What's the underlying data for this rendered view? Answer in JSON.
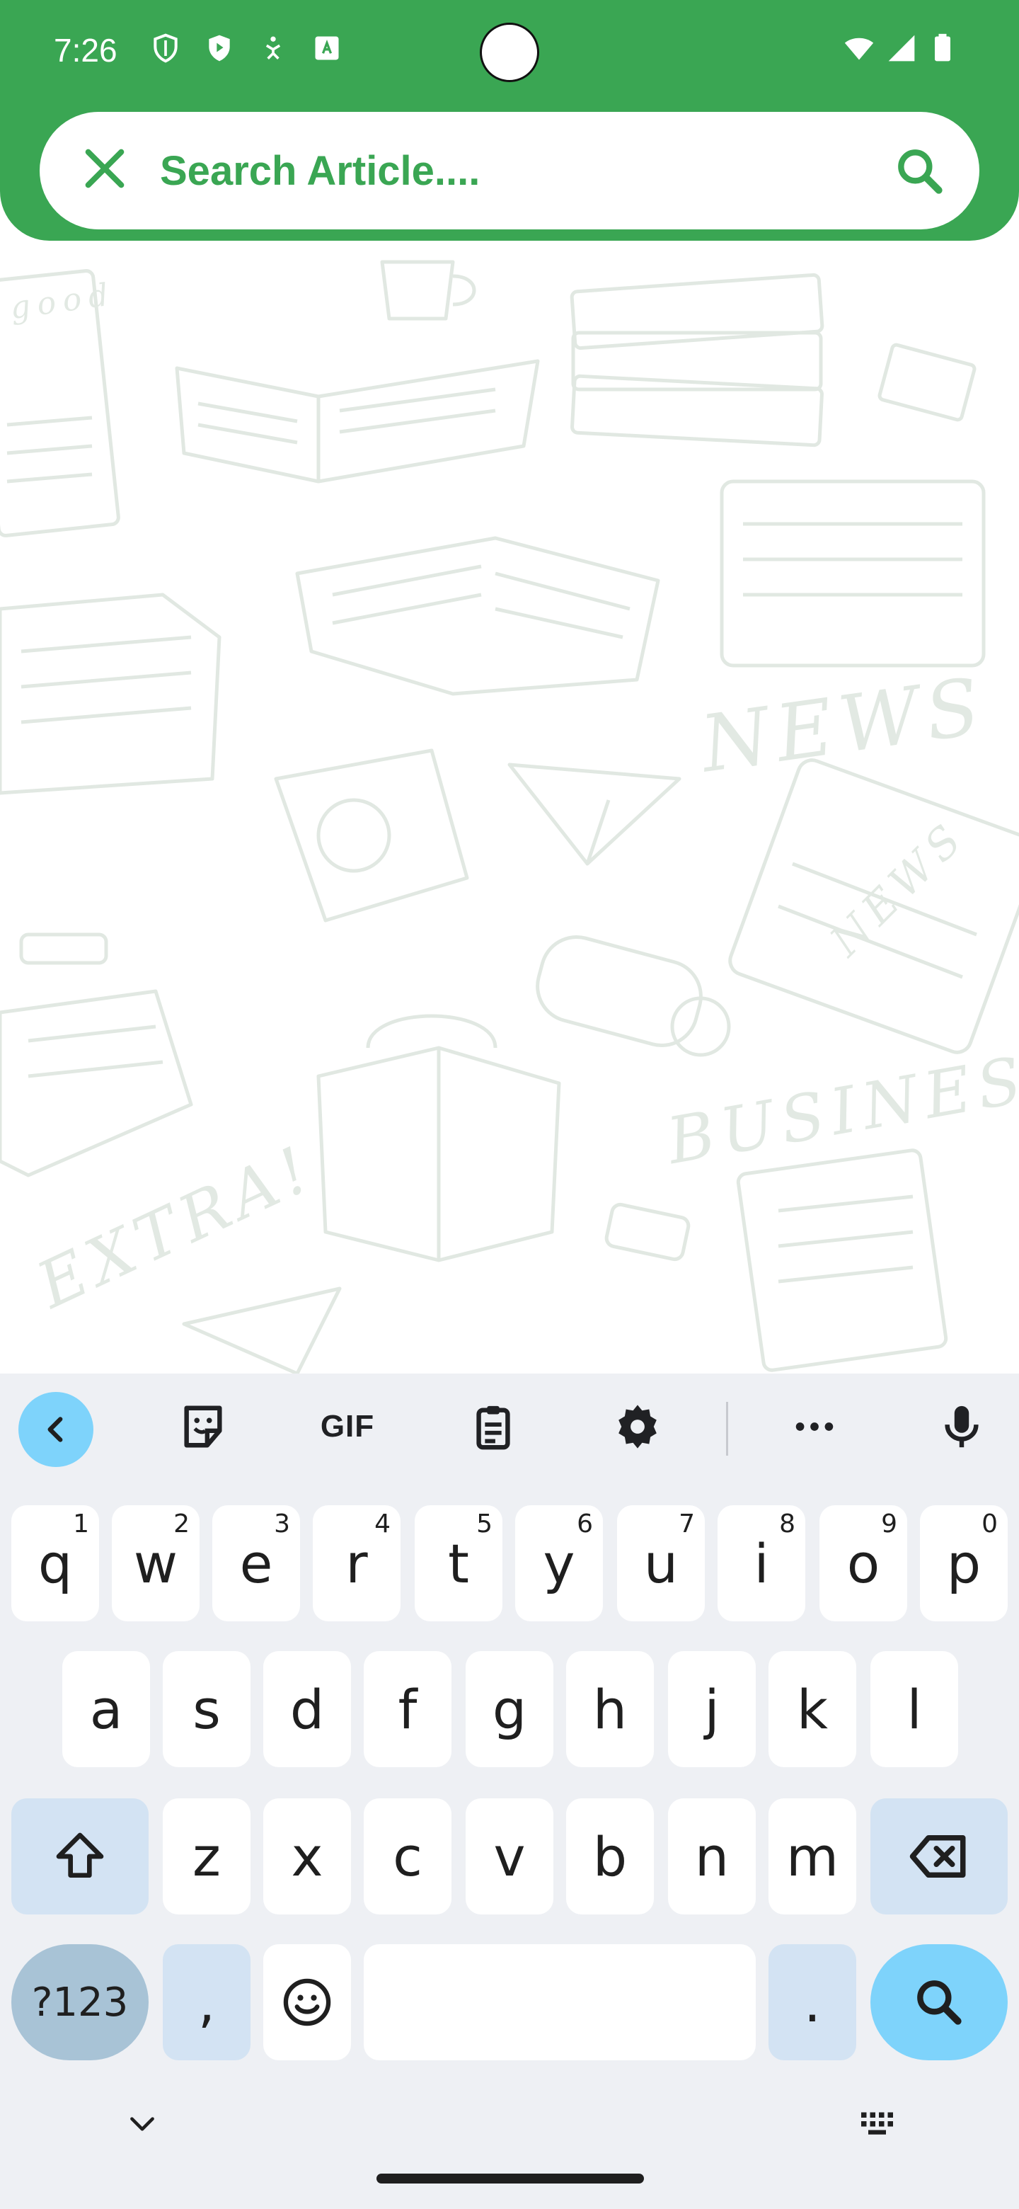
{
  "status_bar": {
    "time": "7:26",
    "left_icons": [
      "shield-outline-icon",
      "play-protect-icon",
      "accessibility-icon",
      "translate-icon"
    ],
    "right_icons": [
      "wifi-icon",
      "signal-icon",
      "battery-icon"
    ]
  },
  "search": {
    "placeholder": "Search Article....",
    "close_icon": "close-icon",
    "search_icon": "search-icon"
  },
  "background_art": {
    "words": [
      "NEWS",
      "BUSINESS",
      "EXTRA!",
      "good",
      "NEWS"
    ]
  },
  "keyboard": {
    "toolbar": [
      "back-chevron-icon",
      "sticker-icon",
      "GIF",
      "clipboard-icon",
      "settings-icon",
      "more-icon",
      "mic-icon"
    ],
    "gif_label": "GIF",
    "row1": [
      {
        "key": "q",
        "hint": "1"
      },
      {
        "key": "w",
        "hint": "2"
      },
      {
        "key": "e",
        "hint": "3"
      },
      {
        "key": "r",
        "hint": "4"
      },
      {
        "key": "t",
        "hint": "5"
      },
      {
        "key": "y",
        "hint": "6"
      },
      {
        "key": "u",
        "hint": "7"
      },
      {
        "key": "i",
        "hint": "8"
      },
      {
        "key": "o",
        "hint": "9"
      },
      {
        "key": "p",
        "hint": "0"
      }
    ],
    "row2": [
      "a",
      "s",
      "d",
      "f",
      "g",
      "h",
      "j",
      "k",
      "l"
    ],
    "row3": [
      "z",
      "x",
      "c",
      "v",
      "b",
      "n",
      "m"
    ],
    "symbols_label": "?123",
    "comma_label": ",",
    "period_label": ".",
    "accent_color": "#7ed3fb",
    "brand_color": "#3aa653"
  }
}
